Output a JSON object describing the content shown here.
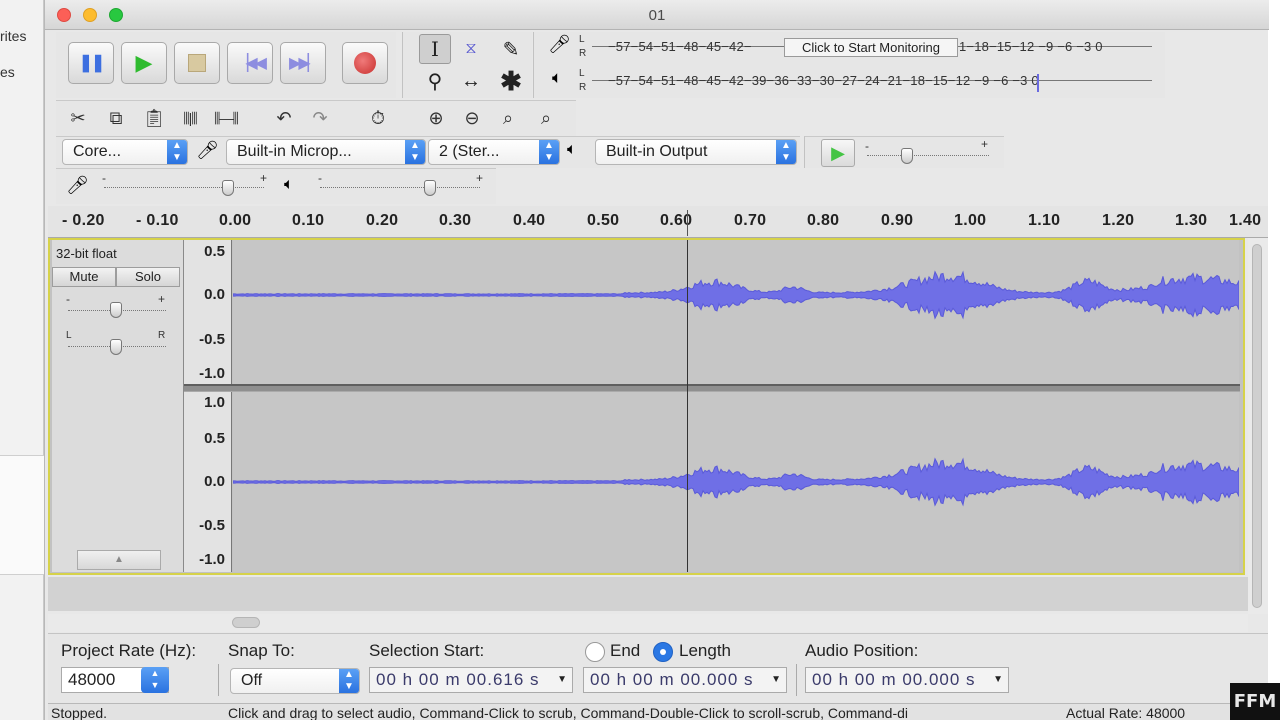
{
  "background": {
    "sidebar_fragments": [
      "rites",
      "es"
    ]
  },
  "watermark": "FFM",
  "window": {
    "title": "01"
  },
  "transport": {
    "pause": "pause-icon",
    "play": "play-icon",
    "stop": "stop-icon",
    "skip_start": "skip-to-start-icon",
    "skip_end": "skip-to-end-icon",
    "record": "record-icon"
  },
  "meters": {
    "record_scale": "−57−54−51−48−45−42−",
    "record_scale_right": "1−18−15−12 −9 −6 −3 0",
    "monitor_label": "Click to Start Monitoring",
    "playback_scale": "−57−54−51−48−45−42−39−36−33−30−27−24−21−18−15−12 −9 −6 −3 0",
    "lr": [
      "L",
      "R"
    ]
  },
  "device": {
    "host": "Core...",
    "input": "Built-in Microp...",
    "channels": "2 (Ster...",
    "output": "Built-in Output"
  },
  "ruler": {
    "ticks": [
      "- 0.20",
      "- 0.10",
      "0.00",
      "0.10",
      "0.20",
      "0.30",
      "0.40",
      "0.50",
      "0.60",
      "0.70",
      "0.80",
      "0.90",
      "1.00",
      "1.10",
      "1.20",
      "1.30",
      "1.40"
    ]
  },
  "track": {
    "format": "32-bit float",
    "mute": "Mute",
    "solo": "Solo",
    "gain_minus": "-",
    "gain_plus": "+",
    "pan_left": "L",
    "pan_right": "R",
    "scale_top": [
      "0.5",
      "0.0",
      "-0.5",
      "-1.0"
    ],
    "scale_bottom": [
      "1.0",
      "0.5",
      "0.0",
      "-0.5",
      "-1.0"
    ]
  },
  "selection_bar": {
    "project_rate_label": "Project Rate (Hz):",
    "project_rate_value": "48000",
    "snap_label": "Snap To:",
    "snap_value": "Off",
    "selection_start_label": "Selection Start:",
    "selection_start_value": "00 h 00 m 00.616 s",
    "end_label": "End",
    "length_label": "Length",
    "length_value": "00 h 00 m 00.000 s",
    "audio_position_label": "Audio Position:",
    "audio_position_value": "00 h 00 m 00.000 s"
  },
  "status": {
    "state": "Stopped.",
    "hint": "Click and drag to select audio, Command-Click to scrub, Command-Double-Click to scroll-scrub, Command-di",
    "actual_rate": "Actual Rate: 48000"
  }
}
